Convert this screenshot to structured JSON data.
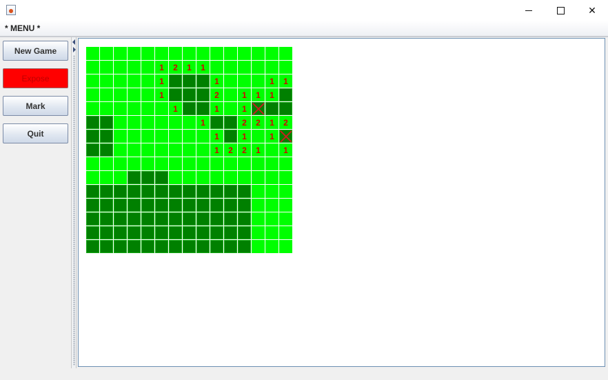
{
  "window": {
    "title": ""
  },
  "menu": {
    "label": "* MENU *"
  },
  "buttons": [
    {
      "id": "new-game",
      "label": "New Game",
      "style": "normal"
    },
    {
      "id": "expose",
      "label": "Expose",
      "style": "red"
    },
    {
      "id": "mark",
      "label": "Mark",
      "style": "normal"
    },
    {
      "id": "quit",
      "label": "Quit",
      "style": "normal"
    }
  ],
  "colors": {
    "hidden": "#008000",
    "exposed": "#00ff00",
    "number": "#d40000",
    "expose_button": "#ff0000",
    "mark_x": "#c81e1e"
  },
  "board": {
    "size": 15,
    "legend": {
      "e": "exposed-empty",
      "h": "hidden",
      "m": "marked",
      "digit": "exposed-number"
    },
    "rows": [
      "eeeeeeeeeeeeeee",
      "eeeee1211eeeeee",
      "eeeee1hhh1eee11",
      "eeeee1hhh2e111h",
      "eeeeee1hh1e1mhh",
      "hheeeeee1hh2212",
      "hheeeeeee1h1e1m",
      "hheeeeeee1221e1",
      "eeeeeeeeeeeeeee",
      "eeehhheeeeeeeee",
      "hhhhhhhhhhhheee",
      "hhhhhhhhhhhheee",
      "hhhhhhhhhhhheee",
      "hhhhhhhhhhhheee",
      "hhhhhhhhhhhheee"
    ]
  }
}
